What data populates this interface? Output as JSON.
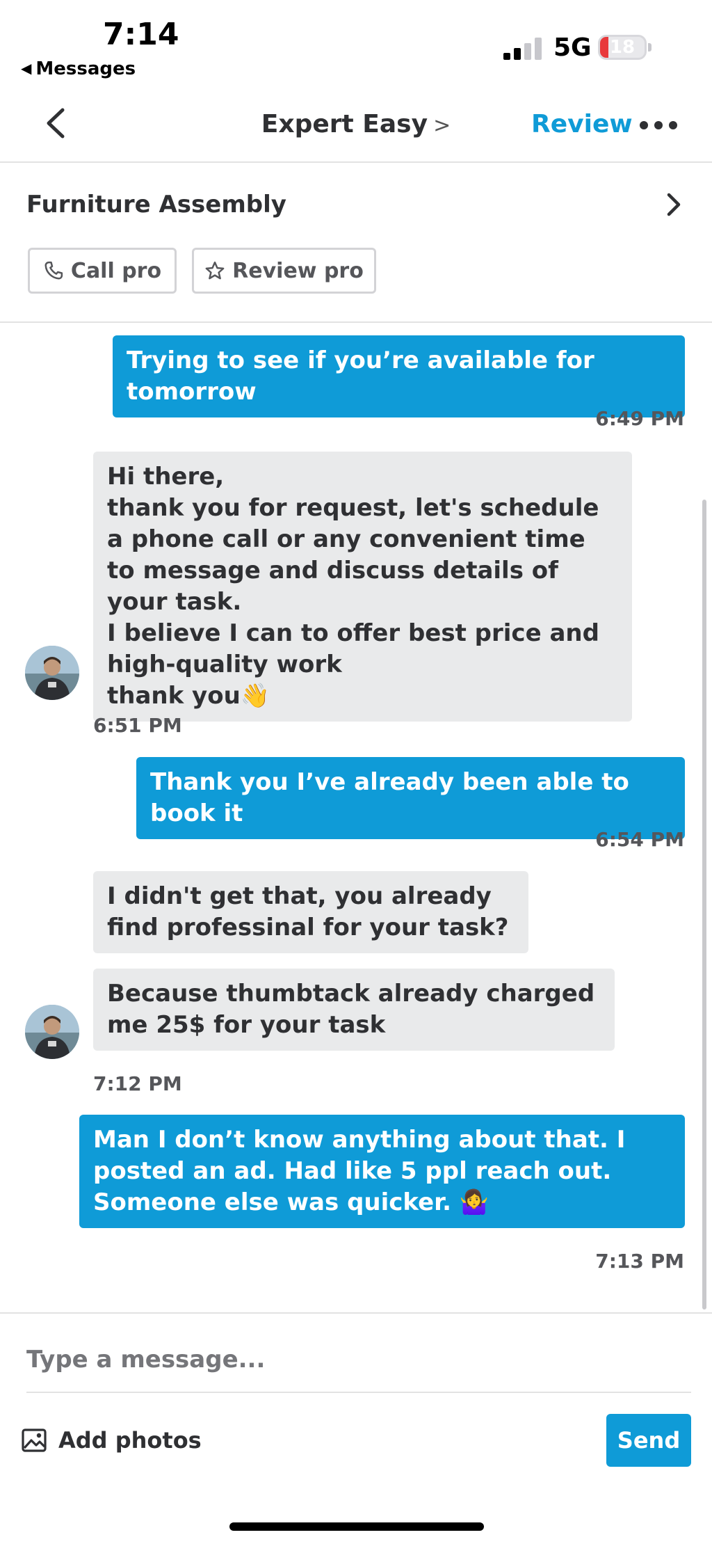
{
  "status_bar": {
    "time": "7:14",
    "back_app": "Messages",
    "network": "5G",
    "battery": "18",
    "battery_level": 0.18
  },
  "nav": {
    "title": "Expert Easy",
    "title_chevron": ">",
    "review_label": "Review"
  },
  "project": {
    "title": "Furniture Assembly",
    "call_label": "Call pro",
    "review_label": "Review pro"
  },
  "messages": [
    {
      "text": "Trying to see if you’re available for tomorrow",
      "time": "6:49 PM",
      "sender": "me"
    },
    {
      "text": "Hi there,\nthank you for request, let's schedule a phone call or any convenient time to message and discuss details of your task.\nI believe I can to offer best price and high-quality work\nthank you👋",
      "time": "6:51 PM",
      "sender": "pro"
    },
    {
      "text": "Thank you I’ve already been able to book it",
      "time": "6:54 PM",
      "sender": "me"
    },
    {
      "text": "I didn't get that, you already find professinal for your task?",
      "sender": "pro"
    },
    {
      "text": "Because thumbtack already charged me 25$ for your task",
      "time": "7:12 PM",
      "sender": "pro"
    },
    {
      "text": "Man I don’t know anything about that. I posted an ad. Had like 5 ppl reach out. Someone else was quicker. 🤷‍♀️",
      "time": "7:13 PM",
      "sender": "me"
    }
  ],
  "composer": {
    "placeholder": "Type a message...",
    "add_photos_label": "Add photos",
    "send_label": "Send"
  },
  "colors": {
    "accent": "#0f9bd7",
    "incoming_bubble": "#e9eaeb",
    "battery_low": "#e8393b"
  }
}
